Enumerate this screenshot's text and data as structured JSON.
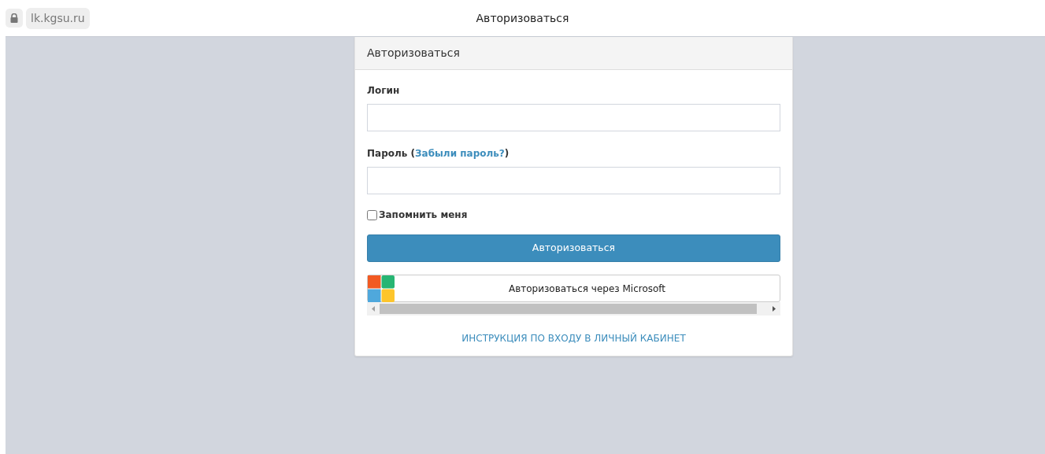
{
  "browser": {
    "url": "lk.kgsu.ru",
    "title": "Авторизоваться"
  },
  "card": {
    "title": "Авторизоваться",
    "fields": [
      {
        "label": "Логин"
      },
      {
        "label": "Пароль (",
        "link": "Забыли пароль?",
        "label_end": ")"
      }
    ],
    "remember": {
      "label": "Запомнить меня",
      "checked": false
    },
    "submit": "Авторизоваться",
    "microsoft_button": "Авторизоваться через Microsoft",
    "instructions_link": "ИНСТРУКЦИЯ ПО ВХОДУ В ЛИЧНЫЙ КАБИНЕТ"
  }
}
